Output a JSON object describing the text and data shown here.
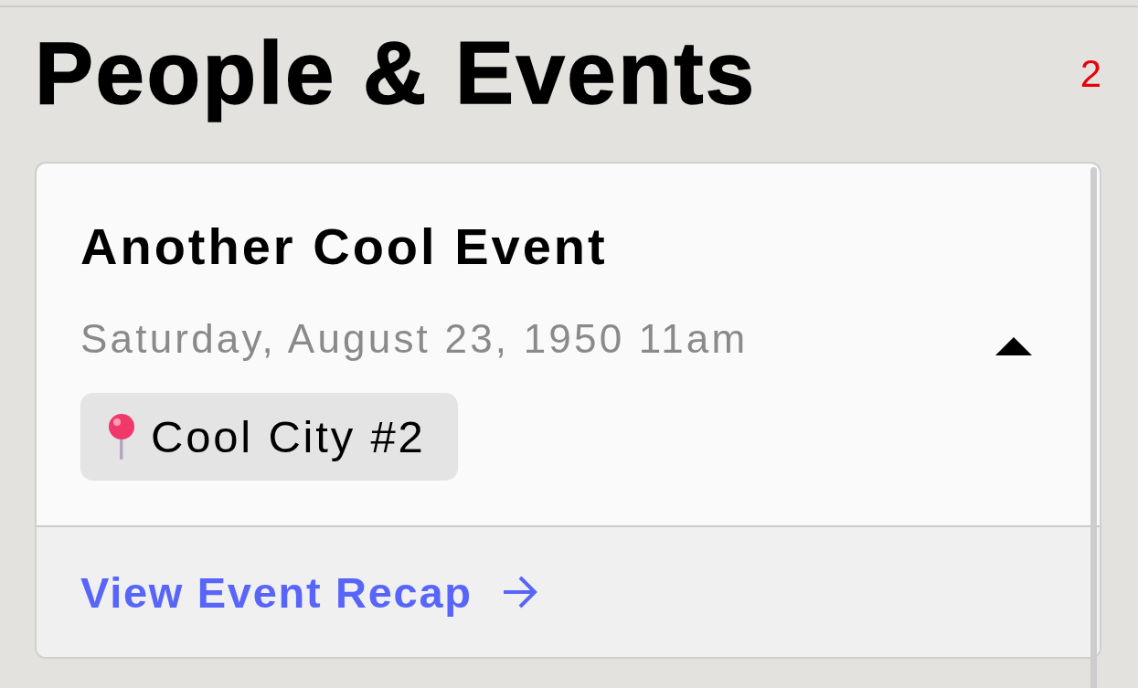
{
  "header": {
    "title": "People & Events",
    "count": "2"
  },
  "events": [
    {
      "title": "Another Cool Event",
      "datetime": "Saturday, August 23, 1950 11am",
      "expanded": true,
      "location": "Cool City #2",
      "link": "View Event Recap"
    }
  ]
}
